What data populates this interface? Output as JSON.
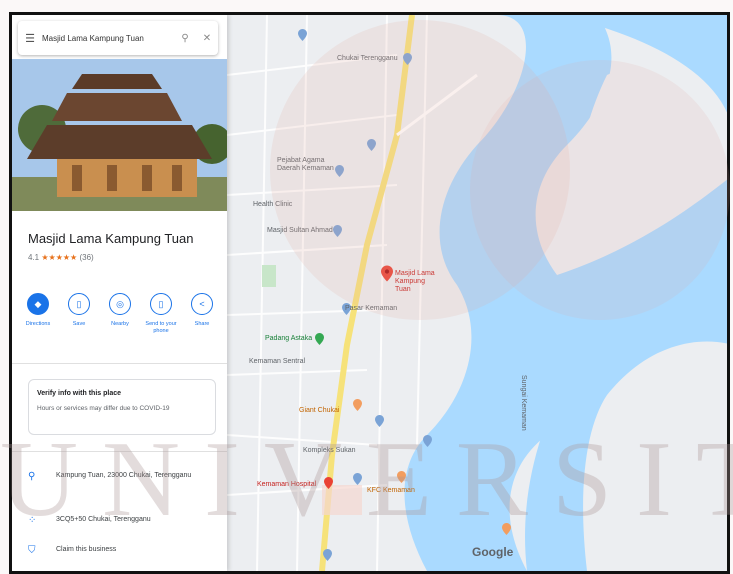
{
  "search": {
    "query": "Masjid Lama Kampung Tuan",
    "menu_icon": "menu-icon",
    "search_icon": "search-icon",
    "close_icon": "close-icon"
  },
  "place": {
    "name": "Masjid Lama Kampung Tuan",
    "rating": "4.1",
    "stars": "★★★★★",
    "review_count": "(36)",
    "actions": [
      {
        "label": "Directions",
        "icon": "directions-icon",
        "glyph": "◆"
      },
      {
        "label": "Save",
        "icon": "bookmark-icon",
        "glyph": "▯"
      },
      {
        "label": "Nearby",
        "icon": "nearby-icon",
        "glyph": "◎"
      },
      {
        "label": "Send to your phone",
        "icon": "phone-icon",
        "glyph": "▯"
      },
      {
        "label": "Share",
        "icon": "share-icon",
        "glyph": "<"
      }
    ],
    "verify_title": "Verify info with this place",
    "verify_text": "Hours or services may differ due to COVID-19",
    "address": "Kampung Tuan, 23000 Chukai, Terengganu",
    "plus_code": "3CQ5+50 Chukai, Terengganu",
    "claim": "Claim this business"
  },
  "map": {
    "labels": [
      "Chukai Terengganu",
      "Pejabat Agama Daerah Kemaman",
      "Health Clinic",
      "Masjid Sultan Ahmad",
      "Masjid Lama Kampung Tuan",
      "Pasar Kemaman",
      "Padang Astaka",
      "Kemaman Sentral",
      "Giant Chukai",
      "Kompleks Sukan",
      "Kemaman Hospital",
      "Sungai Kemaman",
      "KFC Kemaman",
      "Google"
    ],
    "water_color": "#aadaff",
    "road_color": "#f6e27a",
    "pin_color": "#ea4335"
  },
  "watermark": {
    "text": "UNIVERSITI"
  }
}
